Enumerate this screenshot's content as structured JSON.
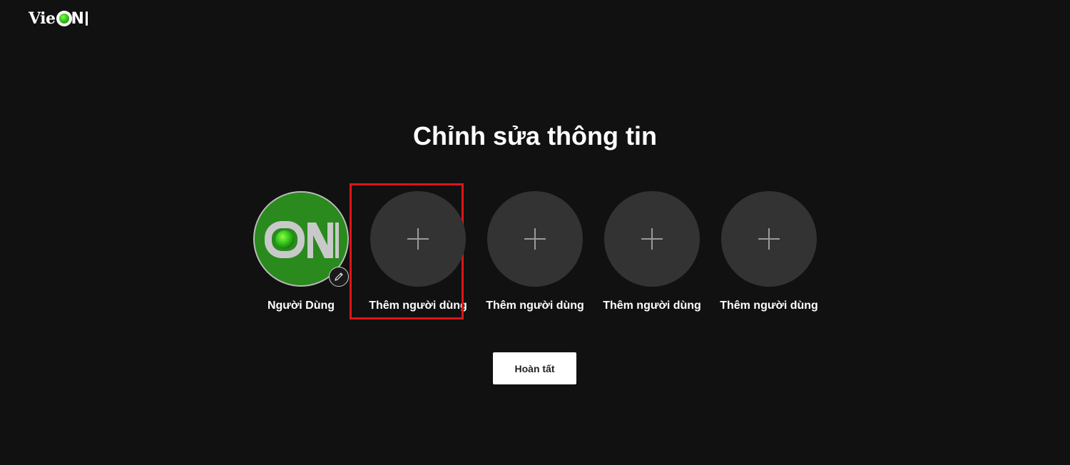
{
  "brand": {
    "logo_prefix": "Vie",
    "logo_n": "N",
    "logo_icon": "vieon-logo"
  },
  "page": {
    "title": "Chỉnh sửa thông tin"
  },
  "profiles": [
    {
      "name": "Người Dùng",
      "type": "user",
      "avatar_icon": "vieon-on-avatar",
      "edit_icon": "pencil-icon"
    },
    {
      "name": "Thêm người dùng",
      "type": "add",
      "icon": "plus-icon",
      "highlighted": true
    },
    {
      "name": "Thêm người dùng",
      "type": "add",
      "icon": "plus-icon"
    },
    {
      "name": "Thêm người dùng",
      "type": "add",
      "icon": "plus-icon"
    },
    {
      "name": "Thêm người dùng",
      "type": "add",
      "icon": "plus-icon"
    }
  ],
  "actions": {
    "done_label": "Hoàn tất"
  },
  "colors": {
    "background": "#111111",
    "add_avatar": "#333333",
    "user_avatar": "#2a8a1e",
    "highlight": "#e0141a",
    "button_bg": "#ffffff"
  }
}
